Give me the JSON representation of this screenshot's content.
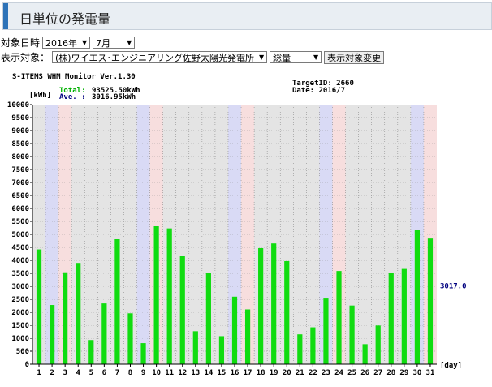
{
  "page": {
    "title": "日単位の発電量"
  },
  "filters": {
    "date_label": "対象日時",
    "year": "2016年",
    "month": "7月",
    "target_label": "表示対象：",
    "station": "(株)ワイエス･エンジニアリング佐野太陽光発電所",
    "metric": "総量",
    "change_button": "表示対象変更"
  },
  "monitor": {
    "header": "S-ITEMS WHM Monitor Ver.1.30",
    "unit": "[kWh]",
    "total_label": "Total:",
    "total_value": "93525.50kWh",
    "ave_label": "Ave. :",
    "ave_value": "3016.95kWh",
    "target_id": "TargetID: 2660",
    "date": "Date: 2016/7",
    "avg_line_label": "3017.0",
    "x_unit": "[day]"
  },
  "colors": {
    "bar": "#10dc10",
    "saturday": "#d9daf5",
    "sunday": "#f7dede",
    "avg_line": "#00007f",
    "total_text": "#00b000",
    "ave_text": "#00007f",
    "plot_bg": "#e4e4e4"
  },
  "chart_data": {
    "type": "bar",
    "categories": [
      "1",
      "2",
      "3",
      "4",
      "5",
      "6",
      "7",
      "8",
      "9",
      "10",
      "11",
      "12",
      "13",
      "14",
      "15",
      "16",
      "17",
      "18",
      "19",
      "20",
      "21",
      "22",
      "23",
      "24",
      "25",
      "26",
      "27",
      "28",
      "29",
      "30",
      "31"
    ],
    "values": [
      4420,
      2280,
      3540,
      3900,
      930,
      2340,
      4840,
      1960,
      810,
      5320,
      5230,
      4180,
      1270,
      3520,
      1080,
      2600,
      2110,
      4470,
      4650,
      3970,
      1150,
      1420,
      2560,
      3590,
      2260,
      770,
      1490,
      3500,
      3700,
      5160,
      4870
    ],
    "saturdays": [
      2,
      9,
      16,
      23,
      30
    ],
    "sundays": [
      3,
      10,
      17,
      24,
      31
    ],
    "average": 3017.0,
    "ylim": [
      0,
      10000
    ],
    "y_ticks": [
      0,
      500,
      1000,
      1500,
      2000,
      2500,
      3000,
      3500,
      4000,
      4500,
      5000,
      5500,
      6000,
      6500,
      7000,
      7500,
      8000,
      8500,
      9000,
      9500,
      10000
    ],
    "grid": true
  }
}
